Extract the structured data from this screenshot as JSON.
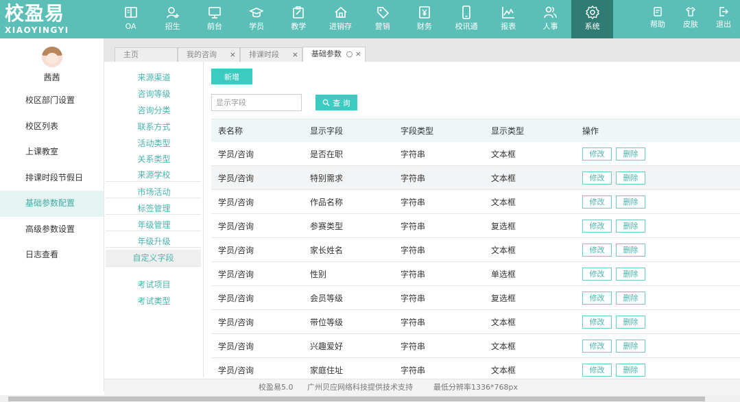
{
  "logo": {
    "cn": "校盈易",
    "en": "XIAOYINGYI"
  },
  "nav": [
    {
      "label": "OA",
      "icon": "book-icon"
    },
    {
      "label": "招生",
      "icon": "user-plus-icon"
    },
    {
      "label": "前台",
      "icon": "monitor-icon"
    },
    {
      "label": "学员",
      "icon": "graduation-cap-icon"
    },
    {
      "label": "教学",
      "icon": "clipboard-icon"
    },
    {
      "label": "进销存",
      "icon": "home-icon"
    },
    {
      "label": "营销",
      "icon": "tag-icon"
    },
    {
      "label": "财务",
      "icon": "yen-icon"
    },
    {
      "label": "校讯通",
      "icon": "phone-icon"
    },
    {
      "label": "报表",
      "icon": "chart-line-icon"
    },
    {
      "label": "人事",
      "icon": "people-icon"
    },
    {
      "label": "系统",
      "icon": "gear-icon"
    }
  ],
  "nav_active": "系统",
  "right_nav": [
    {
      "label": "帮助",
      "icon": "help-icon"
    },
    {
      "label": "皮肤",
      "icon": "shirt-icon"
    },
    {
      "label": "退出",
      "icon": "logout-icon"
    }
  ],
  "user": {
    "name": "茜茜"
  },
  "sidebar": {
    "items": [
      "校区部门设置",
      "校区列表",
      "上课教室",
      "排课时段节假日",
      "基础参数配置",
      "高级参数设置",
      "日志查看"
    ],
    "active": "基础参数配置"
  },
  "tabs": [
    {
      "label": "主页"
    },
    {
      "label": "我的咨询",
      "close": "×"
    },
    {
      "label": "排课时段",
      "close": "×"
    },
    {
      "label": "基础参数",
      "close": "○ ×"
    }
  ],
  "submenu": {
    "items": [
      "来源渠道",
      "咨询等级",
      "咨询分类",
      "联系方式",
      "活动类型",
      "关系类型",
      "来源学校",
      "市场活动",
      "标签管理",
      "年级管理",
      "年级升级",
      "自定义字段",
      "考试项目",
      "考试类型"
    ],
    "active": "自定义字段"
  },
  "toolbar": {
    "add_label": "新增",
    "search_placeholder": "显示字段",
    "search_value": "",
    "query_label": "查 询"
  },
  "table": {
    "headers": [
      "表名称",
      "显示字段",
      "字段类型",
      "显示类型",
      "操作"
    ],
    "edit_label": "修改",
    "delete_label": "删除",
    "rows": [
      [
        "学员/咨询",
        "是否在职",
        "字符串",
        "文本框"
      ],
      [
        "学员/咨询",
        "特别需求",
        "字符串",
        "文本框"
      ],
      [
        "学员/咨询",
        "作品名称",
        "字符串",
        "文本框"
      ],
      [
        "学员/咨询",
        "参赛类型",
        "字符串",
        "复选框"
      ],
      [
        "学员/咨询",
        "家长姓名",
        "字符串",
        "文本框"
      ],
      [
        "学员/咨询",
        "性别",
        "字符串",
        "单选框"
      ],
      [
        "学员/咨询",
        "会员等级",
        "字符串",
        "复选框"
      ],
      [
        "学员/咨询",
        "带位等级",
        "字符串",
        "文本框"
      ],
      [
        "学员/咨询",
        "兴趣爱好",
        "字符串",
        "文本框"
      ],
      [
        "学员/咨询",
        "家庭住址",
        "字符串",
        "文本框"
      ]
    ]
  },
  "footer": {
    "version": "校盈易5.0",
    "support": "广州贝应网络科技提供技术支持",
    "resolution": "最低分辨率1336*768px"
  },
  "colors": {
    "header": "#5bbfb7",
    "header_active": "#2f7c74",
    "accent": "#3ccbc0",
    "link": "#4ab3aa"
  }
}
